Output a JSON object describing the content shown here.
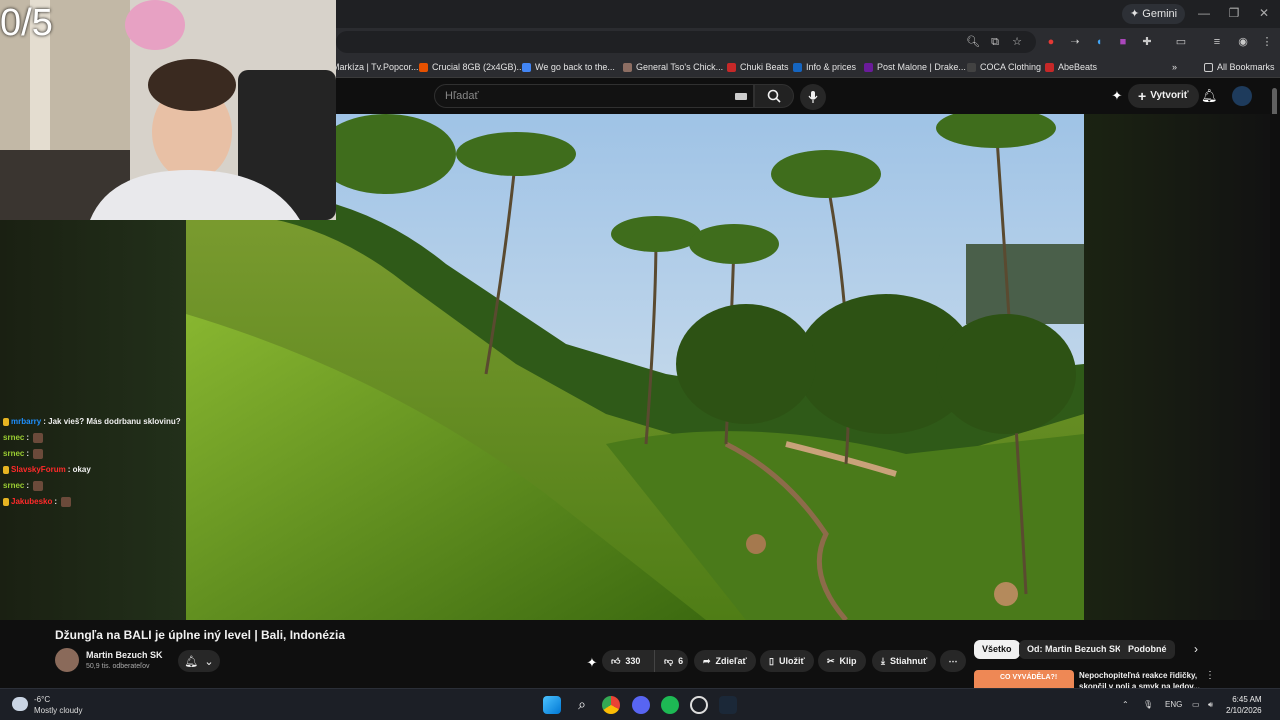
{
  "overlay": {
    "counter": "0/5"
  },
  "browser": {
    "gemini_label": "Gemini",
    "bookmarks": [
      {
        "label": "Markíza | Tv.Popcor...",
        "color": "#1e88e5"
      },
      {
        "label": "Crucial 8GB (2x4GB)...",
        "color": "#e65100"
      },
      {
        "label": "We go back to the...",
        "color": "#4285f4"
      },
      {
        "label": "General Tso's Chick...",
        "color": "#8d6e63"
      },
      {
        "label": "Chuki Beats",
        "color": "#c62828"
      },
      {
        "label": "Info & prices",
        "color": "#1565c0"
      },
      {
        "label": "Post Malone | Drake...",
        "color": "#6a1b9a"
      },
      {
        "label": "COCA Clothing",
        "color": "#424242"
      },
      {
        "label": "AbeBeats",
        "color": "#c62828"
      }
    ],
    "all_bookmarks": "All Bookmarks"
  },
  "youtube": {
    "search_placeholder": "Hľadať",
    "create_label": "Vytvoriť",
    "video": {
      "title": "Džungľa na BALI je úplne iný level | Bali, Indonézia",
      "channel": "Martin Bezuch SK",
      "subscribers": "50,9 tis. odberateľov",
      "likes": "330",
      "dislikes": "6",
      "share": "Zdieľať",
      "save": "Uložiť",
      "clip": "Klip",
      "download": "Stiahnuť"
    },
    "chips": [
      "Všetko",
      "Od: Martin Bezuch SK",
      "Podobné"
    ],
    "recommendation": {
      "title": "Nepochopiteľná reakce řidičky, skončil v poli a smyk na ledov...",
      "thumb_text": "CO VYVÁDĚLA?!"
    }
  },
  "chat": [
    {
      "user": "mrbarry",
      "color": "#1e90ff",
      "text": ": Jak vieš? Más dodrbanu sklovinu?",
      "badge": true,
      "emote": false
    },
    {
      "user": "srnec",
      "color": "#9acd32",
      "text": ":",
      "badge": false,
      "emote": true
    },
    {
      "user": "srnec",
      "color": "#9acd32",
      "text": ":",
      "badge": false,
      "emote": true
    },
    {
      "user": "SlavskyForum",
      "color": "#ff2a2a",
      "text": ": okay",
      "badge": true,
      "emote": false
    },
    {
      "user": "srnec",
      "color": "#9acd32",
      "text": ":",
      "badge": false,
      "emote": true
    },
    {
      "user": "Jakubesko",
      "color": "#ff2a2a",
      "text": ":",
      "badge": true,
      "emote": true
    }
  ],
  "taskbar": {
    "weather_temp": "-6°C",
    "weather_desc": "Mostly cloudy",
    "lang": "ENG",
    "time": "6:45 AM",
    "date": "2/10/2026"
  }
}
